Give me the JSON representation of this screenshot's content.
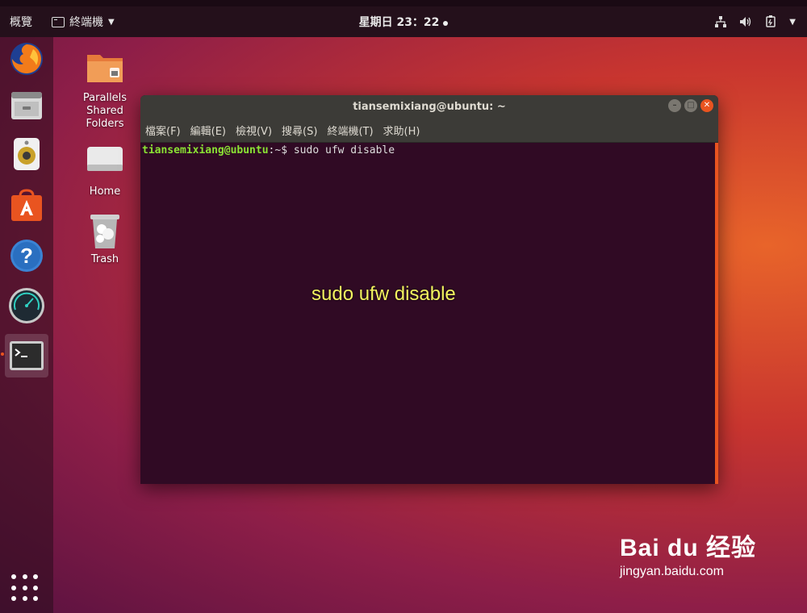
{
  "topbar": {
    "activities_label": "概覽",
    "app_menu_label": "終端機",
    "clock": "星期日 23：22",
    "icons": [
      "network-icon",
      "volume-icon",
      "power-icon",
      "chevron-down-icon"
    ]
  },
  "dock": {
    "items": [
      {
        "name": "firefox",
        "icon": "firefox-icon"
      },
      {
        "name": "files",
        "icon": "file-cabinet-icon"
      },
      {
        "name": "rhythmbox",
        "icon": "speaker-icon"
      },
      {
        "name": "software",
        "icon": "software-center-icon"
      },
      {
        "name": "help",
        "icon": "help-icon"
      },
      {
        "name": "stacer",
        "icon": "speedometer-icon"
      },
      {
        "name": "terminal",
        "icon": "terminal-icon",
        "active": true
      }
    ],
    "show_apps_icon": "apps-grid-icon"
  },
  "desktop": {
    "icons": [
      {
        "label": "Parallels Shared Folders",
        "icon": "folder-icon"
      },
      {
        "label": "Home",
        "icon": "drive-icon"
      },
      {
        "label": "Trash",
        "icon": "trash-icon"
      }
    ]
  },
  "terminal": {
    "title": "tiansemixiang@ubuntu: ~",
    "menu": [
      "檔案(F)",
      "編輯(E)",
      "檢視(V)",
      "搜尋(S)",
      "終端機(T)",
      "求助(H)"
    ],
    "prompt_user": "tiansemixiang@ubuntu",
    "prompt_path": ":~",
    "prompt_symbol": "$ ",
    "command": "sudo ufw disable",
    "caption": "sudo ufw disable"
  },
  "watermark": {
    "brand": "Bai du 经验",
    "url": "jingyan.baidu.com"
  },
  "colors": {
    "accent": "#e95420",
    "terminal_bg": "#300a24",
    "prompt_user": "#8ae234",
    "prompt_path": "#729fcf",
    "caption": "#f3f360"
  }
}
